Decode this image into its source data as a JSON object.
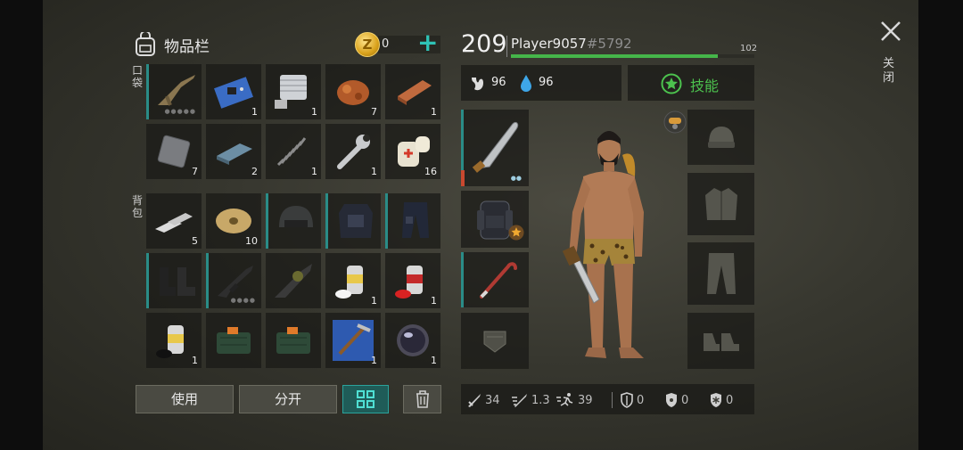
{
  "inventory": {
    "title": "物品栏",
    "pocket_label": "口袋",
    "backpack_label": "背包",
    "coins": "0"
  },
  "pocket_items": [
    {
      "icon": "rifle-icon",
      "count": "",
      "dots": "●●●●●"
    },
    {
      "icon": "circuit-board-icon",
      "count": "1"
    },
    {
      "icon": "engine-part-icon",
      "count": "1"
    },
    {
      "icon": "copper-ore-icon",
      "count": "7"
    },
    {
      "icon": "copper-ingot-icon",
      "count": "1"
    },
    {
      "icon": "iron-plate-icon",
      "count": "7"
    },
    {
      "icon": "steel-ingot-icon",
      "count": "2"
    },
    {
      "icon": "spring-icon",
      "count": "1"
    },
    {
      "icon": "wrench-icon",
      "count": "1"
    },
    {
      "icon": "bandage-icon",
      "count": "16"
    }
  ],
  "backpack_items": [
    {
      "icon": "silver-bars-icon",
      "count": "5"
    },
    {
      "icon": "wire-spool-icon",
      "count": "10"
    },
    {
      "icon": "helmet-icon",
      "count": ""
    },
    {
      "icon": "body-armor-icon",
      "count": ""
    },
    {
      "icon": "armored-pants-icon",
      "count": ""
    },
    {
      "icon": "boots-icon",
      "count": ""
    },
    {
      "icon": "assault-rifle-icon",
      "count": "",
      "dots": "●●●●"
    },
    {
      "icon": "grenade-launcher-icon",
      "count": ""
    },
    {
      "icon": "white-spray-can-icon",
      "count": "1"
    },
    {
      "icon": "red-spray-can-icon",
      "count": "1"
    },
    {
      "icon": "black-spray-can-icon",
      "count": "1"
    },
    {
      "icon": "explosive-charge-icon",
      "count": ""
    },
    {
      "icon": "explosive-charge-icon",
      "count": ""
    },
    {
      "icon": "blueprint-icon",
      "count": "1"
    },
    {
      "icon": "lens-icon",
      "count": "1"
    }
  ],
  "buttons": {
    "use": "使用",
    "split": "分开"
  },
  "player": {
    "level": "209",
    "name": "Player9057",
    "id": "#5792",
    "xp_value": "102",
    "xp_fraction": 0.85
  },
  "stats": {
    "food": "96",
    "water": "96"
  },
  "skills_label": "技能",
  "bottom_stats": {
    "attack": "34",
    "attack_speed": "1.3",
    "speed": "39",
    "defense": "0",
    "radiation": "0",
    "cold": "0"
  },
  "close_label": "关闭",
  "colors": {
    "accent": "#2a8c87",
    "green": "#4cc24e",
    "teal_plus": "#2fc3b6"
  }
}
